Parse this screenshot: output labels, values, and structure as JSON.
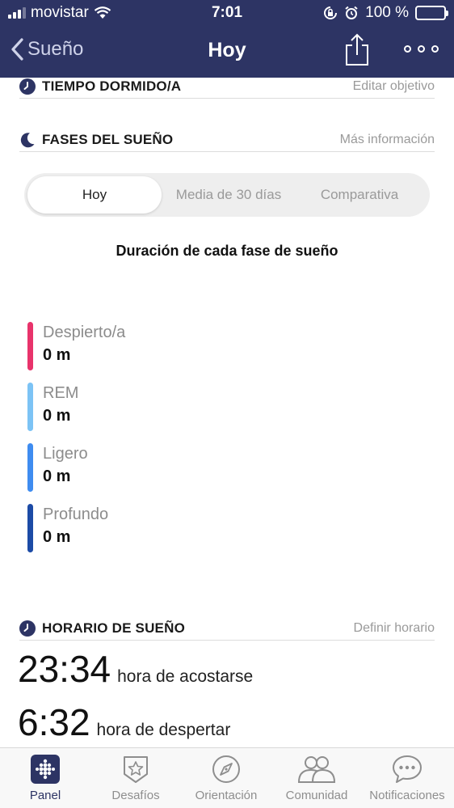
{
  "status_bar": {
    "carrier": "movistar",
    "time": "7:01",
    "battery": "100 %",
    "icons": [
      "signal-icon",
      "wifi-icon",
      "rotation-lock-icon",
      "alarm-icon",
      "battery-icon"
    ]
  },
  "nav": {
    "back_label": "Sueño",
    "title": "Hoy",
    "icons": [
      "chevron-left-icon",
      "share-icon",
      "more-icon"
    ]
  },
  "sections": {
    "tiempo": {
      "title": "TIEMPO DORMIDO/A",
      "link": "Editar objetivo",
      "icon": "clock-icon"
    },
    "fases": {
      "title": "FASES DEL SUEÑO",
      "link": "Más información",
      "icon": "moon-icon"
    },
    "horario": {
      "title": "HORARIO DE SUEÑO",
      "link": "Definir horario",
      "icon": "clock-icon"
    }
  },
  "segmented": {
    "tabs": [
      "Hoy",
      "Media de 30 días",
      "Comparativa"
    ],
    "selected": "Hoy"
  },
  "phases": {
    "title": "Duración de cada fase de sueño",
    "items": [
      {
        "name": "Despierto/a",
        "value": "0 m",
        "color": "#e8336b"
      },
      {
        "name": "REM",
        "value": "0 m",
        "color": "#7cc3f5"
      },
      {
        "name": "Ligero",
        "value": "0 m",
        "color": "#3f8cf0"
      },
      {
        "name": "Profundo",
        "value": "0 m",
        "color": "#1c4ba6"
      }
    ]
  },
  "schedule": {
    "bedtime": {
      "time": "23:34",
      "label": "hora de acostarse"
    },
    "wake": {
      "time": "6:32",
      "label": "hora de despertar"
    }
  },
  "tabbar": {
    "items": [
      {
        "label": "Panel",
        "icon": "grid-dots-icon"
      },
      {
        "label": "Desafíos",
        "icon": "star-badge-icon"
      },
      {
        "label": "Orientación",
        "icon": "compass-icon"
      },
      {
        "label": "Comunidad",
        "icon": "community-icon"
      },
      {
        "label": "Notificaciones",
        "icon": "chat-bubble-icon"
      }
    ],
    "selected": "Panel"
  },
  "colors": {
    "nav_background": "#2d3464",
    "accent": "#2d3464",
    "muted_text": "#9a9a9a"
  }
}
